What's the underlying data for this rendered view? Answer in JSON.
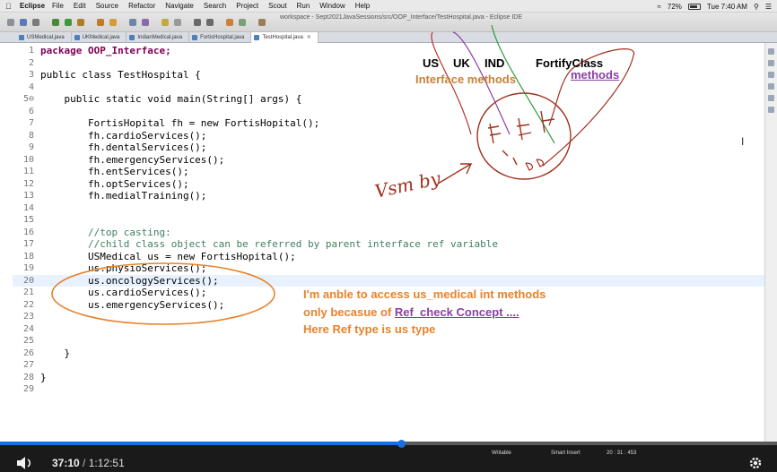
{
  "menubar": {
    "app": "Eclipse",
    "items": [
      "File",
      "Edit",
      "Source",
      "Refactor",
      "Navigate",
      "Search",
      "Project",
      "Scout",
      "Run",
      "Window",
      "Help"
    ],
    "battery": "72%",
    "clock": "Tue 7:40 AM"
  },
  "window": {
    "title": "workspace - Sept2021JavaSessions/src/OOP_Interface/TestHospital.java - Eclipse IDE"
  },
  "tabs": [
    {
      "label": "USMedical.java",
      "active": false
    },
    {
      "label": "UKMedical.java",
      "active": false
    },
    {
      "label": "IndianMedical.java",
      "active": false
    },
    {
      "label": "FortisHospital.java",
      "active": false
    },
    {
      "label": "TestHospital.java",
      "active": true
    }
  ],
  "code_lines": [
    {
      "num": "1",
      "text": "package OOP_Interface;"
    },
    {
      "num": "2",
      "text": ""
    },
    {
      "num": "3",
      "text": "public class TestHospital {"
    },
    {
      "num": "4",
      "text": ""
    },
    {
      "num": "5⊖",
      "text": "    public static void main(String[] args) {"
    },
    {
      "num": "6",
      "text": ""
    },
    {
      "num": "7",
      "text": "        FortisHopital fh = new FortisHopital();"
    },
    {
      "num": "8",
      "text": "        fh.cardioServices();"
    },
    {
      "num": "9",
      "text": "        fh.dentalServices();"
    },
    {
      "num": "10",
      "text": "        fh.emergencyServices();"
    },
    {
      "num": "11",
      "text": "        fh.entServices();"
    },
    {
      "num": "12",
      "text": "        fh.optServices();"
    },
    {
      "num": "13",
      "text": "        fh.medialTraining();"
    },
    {
      "num": "14",
      "text": ""
    },
    {
      "num": "15",
      "text": ""
    },
    {
      "num": "16",
      "text": "        //top casting:"
    },
    {
      "num": "17",
      "text": "        //child class object can be referred by parent interface ref variable"
    },
    {
      "num": "18",
      "text": "        USMedical us = new FortisHopital();"
    },
    {
      "num": "19",
      "text": "        us.physioServices();"
    },
    {
      "num": "20",
      "text": "        us.oncologyServices();"
    },
    {
      "num": "21",
      "text": "        us.cardioServices();"
    },
    {
      "num": "22",
      "text": "        us.emergencyServices();"
    },
    {
      "num": "23",
      "text": ""
    },
    {
      "num": "24",
      "text": ""
    },
    {
      "num": "25",
      "text": ""
    },
    {
      "num": "26",
      "text": "    }"
    },
    {
      "num": "27",
      "text": ""
    },
    {
      "num": "28",
      "text": "}"
    },
    {
      "num": "29",
      "text": ""
    }
  ],
  "annotations": {
    "us": "US",
    "uk": "UK",
    "ind": "IND",
    "fortify": "FortifyClass",
    "interface_methods": "Interface methods",
    "methods": "methods",
    "handwriting": "Vsm by",
    "note_line1": "I'm anble to access us_medical int methods",
    "note_line2_prefix": "only becasue of ",
    "note_line2_link": "Ref_check  Concept ....",
    "note_line3": "Here Ref type is us type"
  },
  "status": {
    "writable": "Writable",
    "insert": "Smart Insert",
    "position": "20 : 31 : 453"
  },
  "player": {
    "current": "37:10",
    "separator": "/",
    "total": "1:12:51",
    "progress": 0.516
  },
  "colors": {
    "accent": "#1d6fe0",
    "annotation_orange": "#e8822a",
    "annotation_purple": "#8b3fa5",
    "handwriting_red": "#a0311e"
  }
}
